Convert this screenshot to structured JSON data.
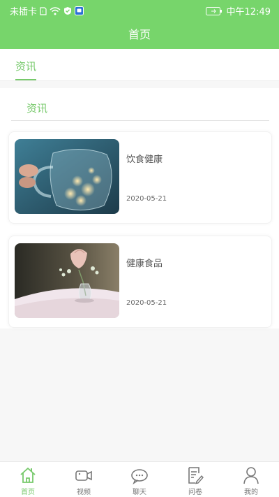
{
  "status_bar": {
    "carrier": "未插卡",
    "time": "中午12:49"
  },
  "header": {
    "title": "首页"
  },
  "tabs": [
    {
      "label": "资讯",
      "active": true
    }
  ],
  "section": {
    "title": "资讯"
  },
  "articles": [
    {
      "title": "饮食健康",
      "date": "2020-05-21",
      "image": "glass-teapot-photo"
    },
    {
      "title": "健康食品",
      "date": "2020-05-21",
      "image": "flower-vase-photo"
    }
  ],
  "bottom_nav": [
    {
      "label": "首页",
      "icon": "home-icon",
      "active": true
    },
    {
      "label": "视频",
      "icon": "video-icon",
      "active": false
    },
    {
      "label": "聊天",
      "icon": "chat-icon",
      "active": false
    },
    {
      "label": "问卷",
      "icon": "survey-icon",
      "active": false
    },
    {
      "label": "我的",
      "icon": "profile-icon",
      "active": false
    }
  ],
  "colors": {
    "accent": "#77d56b",
    "accent_text": "#77c96b"
  }
}
